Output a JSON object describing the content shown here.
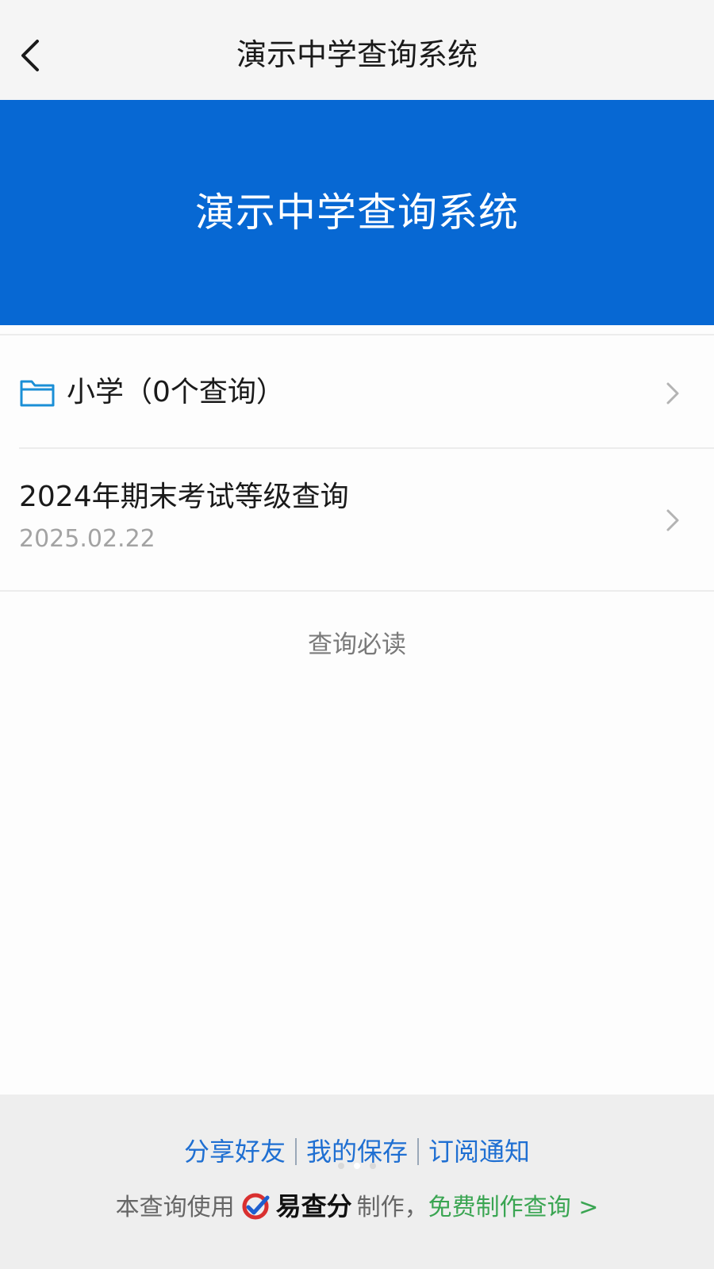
{
  "nav": {
    "title": "演示中学查询系统"
  },
  "banner": {
    "title": "演示中学查询系统"
  },
  "folder": {
    "label": "小学（0个查询）"
  },
  "query": {
    "title": "2024年期末考试等级查询",
    "date": "2025.02.22"
  },
  "notice": {
    "label": "查询必读"
  },
  "footer": {
    "links": [
      "分享好友",
      "我的保存",
      "订阅通知"
    ],
    "credit_prefix": "本查询使用",
    "brand_name": "易查分",
    "credit_suffix": "制作，",
    "make_link": "免费制作查询 >"
  },
  "icons": {
    "back": "chevron-left-icon",
    "folder": "folder-icon",
    "row_arrow": "chevron-right-icon",
    "brand": "yichafen-logo-icon"
  },
  "colors": {
    "banner": "#0768d3",
    "link_blue": "#1f6fd2",
    "link_green": "#3aa552",
    "folder_icon": "#1a8fd6"
  }
}
